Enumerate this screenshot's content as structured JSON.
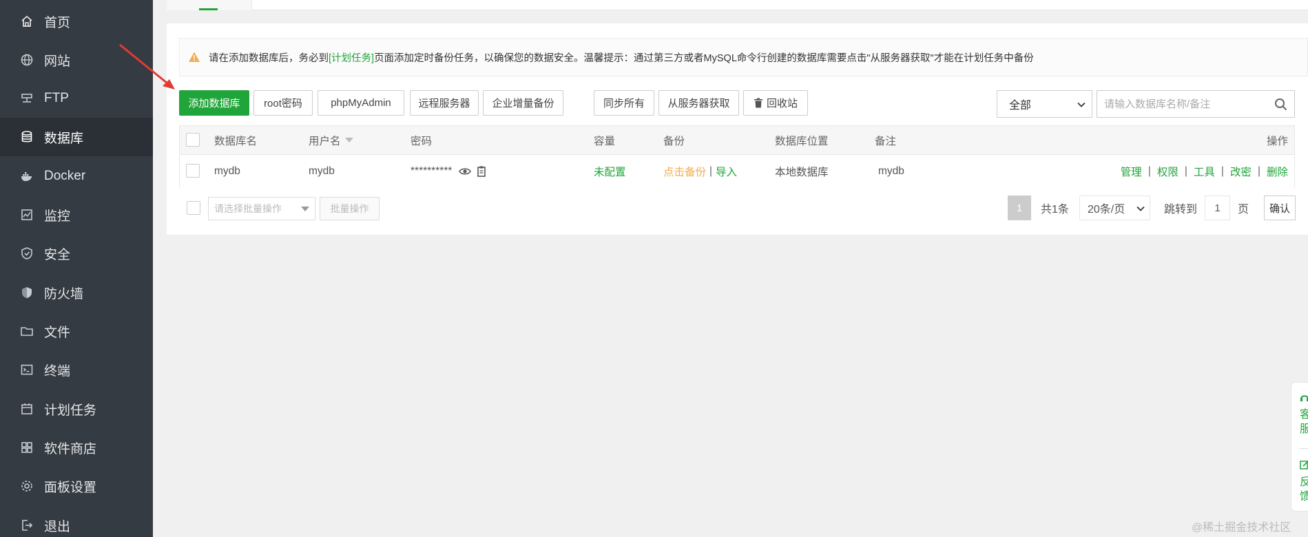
{
  "sidebar": {
    "items": [
      {
        "label": "首页",
        "icon": "home-icon"
      },
      {
        "label": "网站",
        "icon": "globe-icon"
      },
      {
        "label": "FTP",
        "icon": "ftp-icon"
      },
      {
        "label": "数据库",
        "icon": "database-icon"
      },
      {
        "label": "Docker",
        "icon": "docker-icon"
      },
      {
        "label": "监控",
        "icon": "monitor-icon"
      },
      {
        "label": "安全",
        "icon": "shield-check-icon"
      },
      {
        "label": "防火墙",
        "icon": "firewall-icon"
      },
      {
        "label": "文件",
        "icon": "folder-icon"
      },
      {
        "label": "终端",
        "icon": "terminal-icon"
      },
      {
        "label": "计划任务",
        "icon": "calendar-icon"
      },
      {
        "label": "软件商店",
        "icon": "apps-icon"
      },
      {
        "label": "面板设置",
        "icon": "gear-icon"
      },
      {
        "label": "退出",
        "icon": "logout-icon"
      }
    ],
    "active_index": 3
  },
  "alert": {
    "before": "请在添加数据库后，务必到",
    "link": "[计划任务]",
    "after": "页面添加定时备份任务，以确保您的数据安全。温馨提示：通过第三方或者MySQL命令行创建的数据库需要点击\"从服务器获取\"才能在计划任务中备份"
  },
  "toolbar": {
    "add_db": "添加数据库",
    "root_pw": "root密码",
    "phpmyadmin": "phpMyAdmin",
    "remote_server": "远程服务器",
    "enterprise_backup": "企业增量备份",
    "sync_all": "同步所有",
    "fetch_from_server": "从服务器获取",
    "recycle_bin": "回收站",
    "filter_value": "全部",
    "search_placeholder": "请输入数据库名称/备注"
  },
  "table": {
    "headers": {
      "name": "数据库名",
      "user": "用户名",
      "password": "密码",
      "capacity": "容量",
      "backup": "备份",
      "location": "数据库位置",
      "note": "备注",
      "actions": "操作"
    },
    "rows": [
      {
        "name": "mydb",
        "user": "mydb",
        "password": "**********",
        "capacity": "未配置",
        "backup_link": "点击备份",
        "import_link": "导入",
        "location": "本地数据库",
        "note": "mydb",
        "actions": [
          "管理",
          "权限",
          "工具",
          "改密",
          "删除"
        ]
      }
    ]
  },
  "batch": {
    "select_placeholder": "请选择批量操作",
    "button": "批量操作"
  },
  "pagination": {
    "current": "1",
    "total": "共1条",
    "page_size": "20条/页",
    "jump_label": "跳转到",
    "jump_value": "1",
    "page_unit": "页",
    "confirm": "确认"
  },
  "float_panel": {
    "service": "客服",
    "feedback": "反馈"
  },
  "watermark": "@稀土掘金技术社区",
  "colors": {
    "accent": "#20a53a",
    "sidebar_bg": "#353b42",
    "warning": "#f0ad4e"
  }
}
